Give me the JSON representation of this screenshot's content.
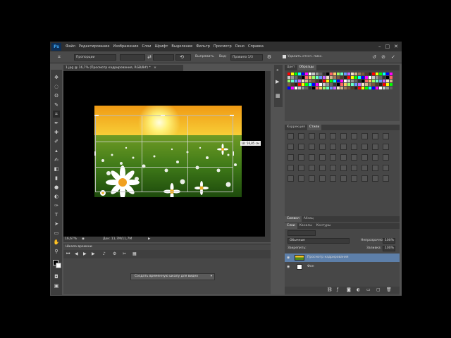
{
  "app": {
    "logo": "Ps",
    "menu": [
      "Файл",
      "Редактирование",
      "Изображение",
      "Слои",
      "Шрифт",
      "Выделение",
      "Фильтр",
      "Просмотр",
      "Окно",
      "Справка"
    ],
    "window_controls": [
      "–",
      "□",
      "✕"
    ]
  },
  "options": {
    "ratio_value": "Пропорции",
    "straighten_label": "Выпрямить",
    "view_label": "Вид:",
    "view_value": "Правило 1/3",
    "delete_cropped_label": "Удалить отсеч. пикс."
  },
  "document": {
    "tab_title": "1.jpg @ 16,7% (Просмотр кадрирования, RGB/8#) *",
    "tab_close": "×",
    "zoom": "16,67%",
    "doc_info": "Док: 11,7M/11,7M",
    "size_tooltip": "Ш: 56,85 см"
  },
  "timeline": {
    "title": "Шкала времени",
    "create_button": "Создать временную шкалу для видео"
  },
  "panels": {
    "color_tabs": [
      "Цвет",
      "Образцы"
    ],
    "styles_tabs": [
      "Коррекция",
      "Стили"
    ],
    "layers_tabs": [
      "Слои",
      "Каналы",
      "Контуры"
    ],
    "paragraph_tabs": [
      "Символ",
      "Абзац"
    ],
    "blend_mode": "Обычные",
    "opacity_label": "Непрозрачность:",
    "opacity_value": "100%",
    "lock_label": "Закрепить:",
    "fill_label": "Заливка:",
    "fill_value": "100%",
    "layers": [
      {
        "name": "Просмотр кадрирования",
        "selected": true
      },
      {
        "name": "Фон",
        "selected": false
      }
    ]
  },
  "colors": {
    "selected_layer": "#5d7fa9"
  }
}
